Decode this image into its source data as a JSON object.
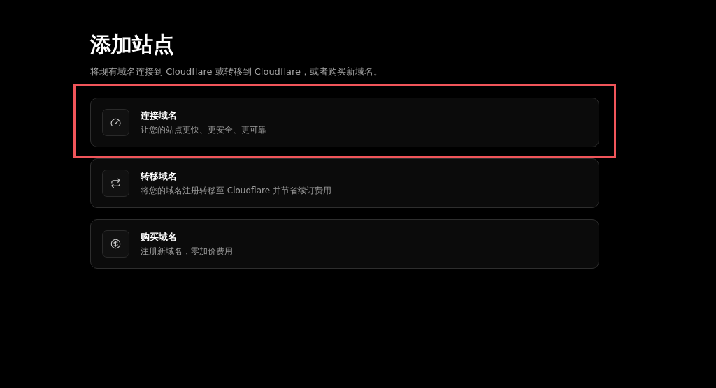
{
  "title": "添加站点",
  "subtitle": "将现有域名连接到 Cloudflare 或转移到 Cloudflare，或者购买新域名。",
  "options": [
    {
      "kind": "gauge",
      "title": "连接域名",
      "description": "让您的站点更快、更安全、更可靠",
      "highlighted": true
    },
    {
      "kind": "transfer",
      "title": "转移域名",
      "description": "将您的域名注册转移至 Cloudflare 并节省续订费用",
      "highlighted": false
    },
    {
      "kind": "dollar",
      "title": "购买域名",
      "description": "注册新域名，零加价费用",
      "highlighted": false
    }
  ]
}
